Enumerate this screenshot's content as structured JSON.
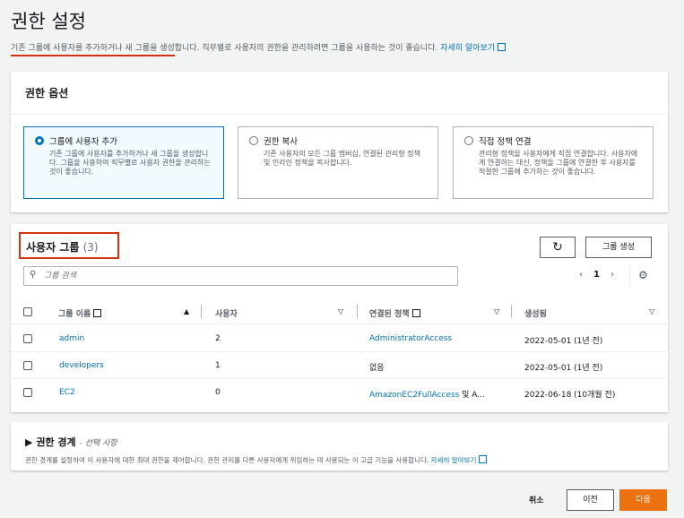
{
  "header": {
    "title": "권한 설정",
    "desc_underlined": "기존 그룹에 사용자를 추가하거나 새 그룹을 생성",
    "desc_rest": "합니다. 직무별로 사용자의 권한을 관리하려면 그룹을 사용하는 것이 좋습니다.",
    "learn_more": "자세히 알아보기"
  },
  "perm_options": {
    "title": "권한 옵션",
    "options": [
      {
        "title": "그룹에 사용자 추가",
        "desc": "기존 그룹에 사용자를 추가하거나 새 그룹을 생성합니다. 그룹을 사용하여 직무별로 사용자 권한을 관리하는 것이 좋습니다."
      },
      {
        "title": "권한 복사",
        "desc": "기존 사용자의 모든 그룹 멤버십, 연결된 관리형 정책 및 인라인 정책을 복사합니다."
      },
      {
        "title": "직접 정책 연결",
        "desc": "관리형 정책을 사용자에게 직접 연결합니다. 사용자에게 연결하는 대신, 정책을 그룹에 연결한 후 사용자를 적절한 그룹에 추가하는 것이 좋습니다."
      }
    ]
  },
  "groups": {
    "title": "사용자 그룹",
    "count": "(3)",
    "create_label": "그룹 생성",
    "refresh_icon": "↻",
    "search_placeholder": "그룹 검색",
    "page": "1",
    "columns": [
      "그룹 이름",
      "사용자",
      "연결된 정책",
      "생성됨"
    ],
    "rows": [
      {
        "name": "admin",
        "users": "2",
        "policy": "AdministratorAccess",
        "policy_extra": "",
        "created": "2022-05-01 (1년 전)"
      },
      {
        "name": "developers",
        "users": "1",
        "policy": "",
        "policy_extra": "없음",
        "created": "2022-05-01 (1년 전)"
      },
      {
        "name": "EC2",
        "users": "0",
        "policy": "AmazonEC2FullAccess",
        "policy_extra": " 및 A...",
        "created": "2022-06-18 (10개월 전)"
      }
    ]
  },
  "boundary": {
    "title": "권한 경계",
    "optional": "- 선택 사항",
    "desc": "권한 경계를 설정하여 이 사용자에 대한 최대 권한을 제어합니다. 권한 관리를 다른 사용자에게 위임하는 데 사용되는 이 고급 기능을 사용합니다.",
    "learn_more": "자세히 알아보기"
  },
  "footer": {
    "cancel": "취소",
    "prev": "이전",
    "next": "다음"
  }
}
